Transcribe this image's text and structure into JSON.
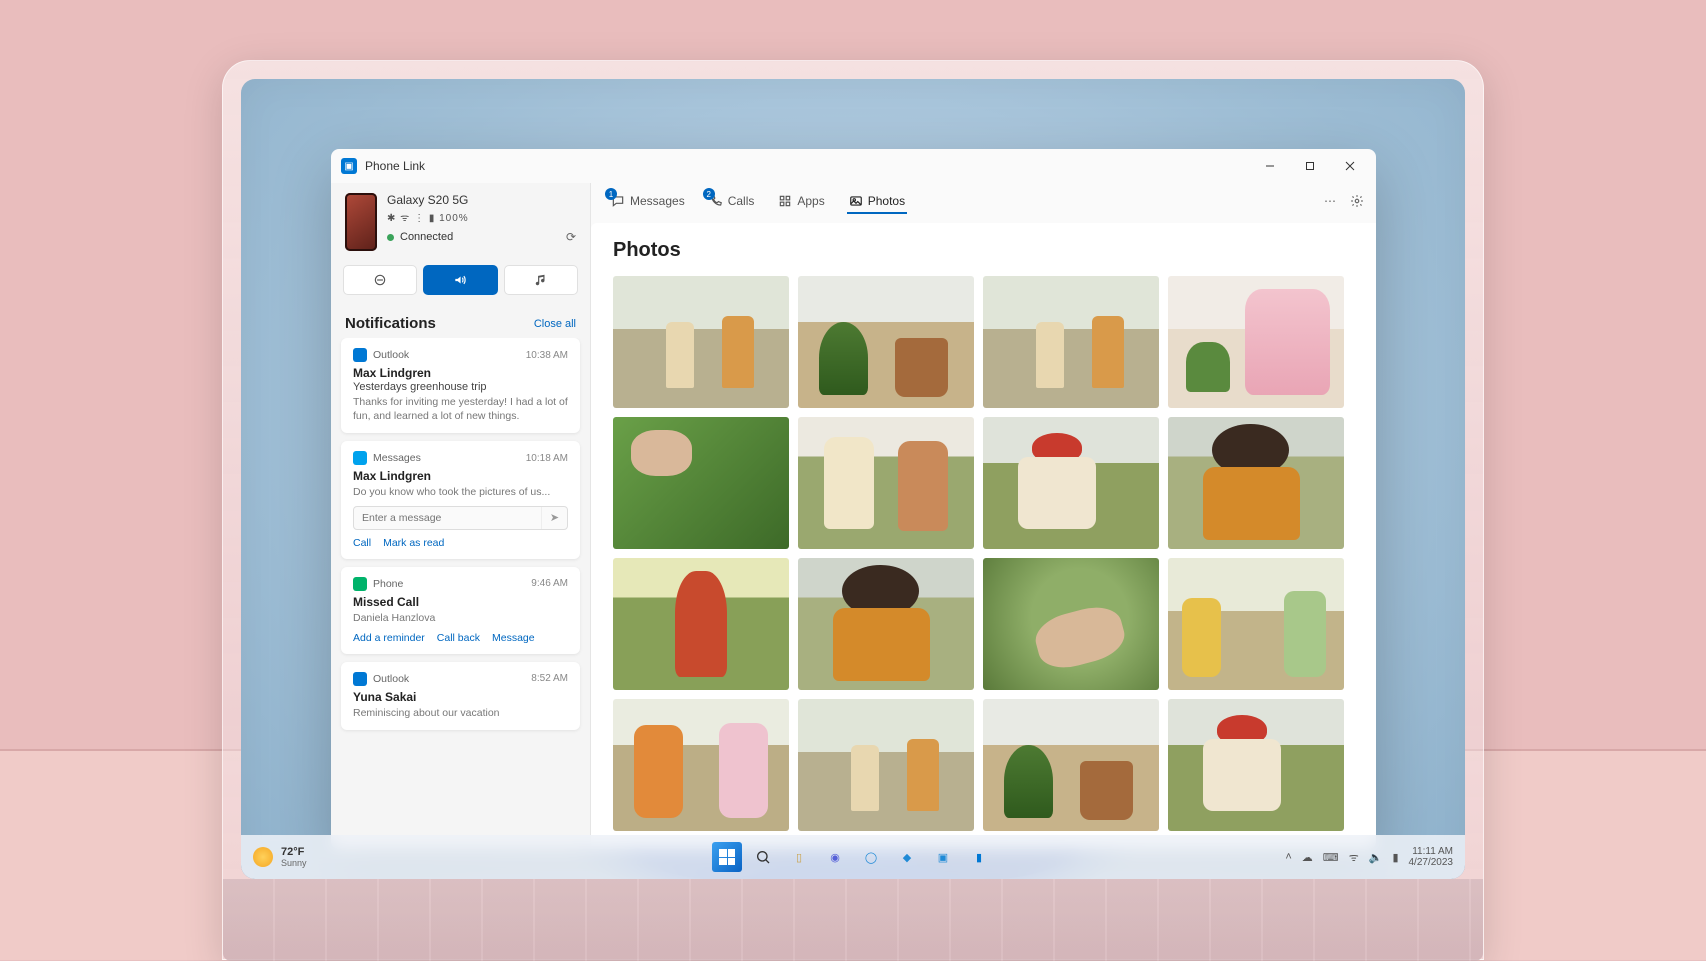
{
  "window": {
    "title": "Phone Link"
  },
  "device": {
    "name": "Galaxy S20 5G",
    "status_icons": "✱ ᯤ ⋮ ▮ 100%",
    "status_label": "Connected"
  },
  "notifications_header": {
    "title": "Notifications",
    "close_all_label": "Close all"
  },
  "notifications": [
    {
      "app": "Outlook",
      "icon": "ico-outlook",
      "time": "10:38 AM",
      "sender": "Max Lindgren",
      "subject": "Yesterdays greenhouse trip",
      "body": "Thanks for inviting me yesterday! I had a lot of fun, and learned a lot of new things."
    },
    {
      "app": "Messages",
      "icon": "ico-msg",
      "time": "10:18 AM",
      "sender": "Max Lindgren",
      "body": "Do you know who took the pictures of us...",
      "input_placeholder": "Enter a message",
      "actions": [
        "Call",
        "Mark as read"
      ]
    },
    {
      "app": "Phone",
      "icon": "ico-phone",
      "time": "9:46 AM",
      "sender": "Missed Call",
      "body": "Daniela Hanzlova",
      "actions": [
        "Add a reminder",
        "Call back",
        "Message"
      ]
    },
    {
      "app": "Outlook",
      "icon": "ico-outlook",
      "time": "8:52 AM",
      "sender": "Yuna Sakai",
      "body": "Reminiscing about our vacation"
    }
  ],
  "nav": {
    "items": [
      {
        "label": "Messages",
        "badge": "1"
      },
      {
        "label": "Calls",
        "badge": "2"
      },
      {
        "label": "Apps"
      },
      {
        "label": "Photos",
        "active": true
      }
    ]
  },
  "content": {
    "title": "Photos"
  },
  "taskbar": {
    "weather": {
      "temp": "72°F",
      "cond": "Sunny"
    },
    "clock": {
      "time": "11:11 AM",
      "date": "4/27/2023"
    }
  }
}
